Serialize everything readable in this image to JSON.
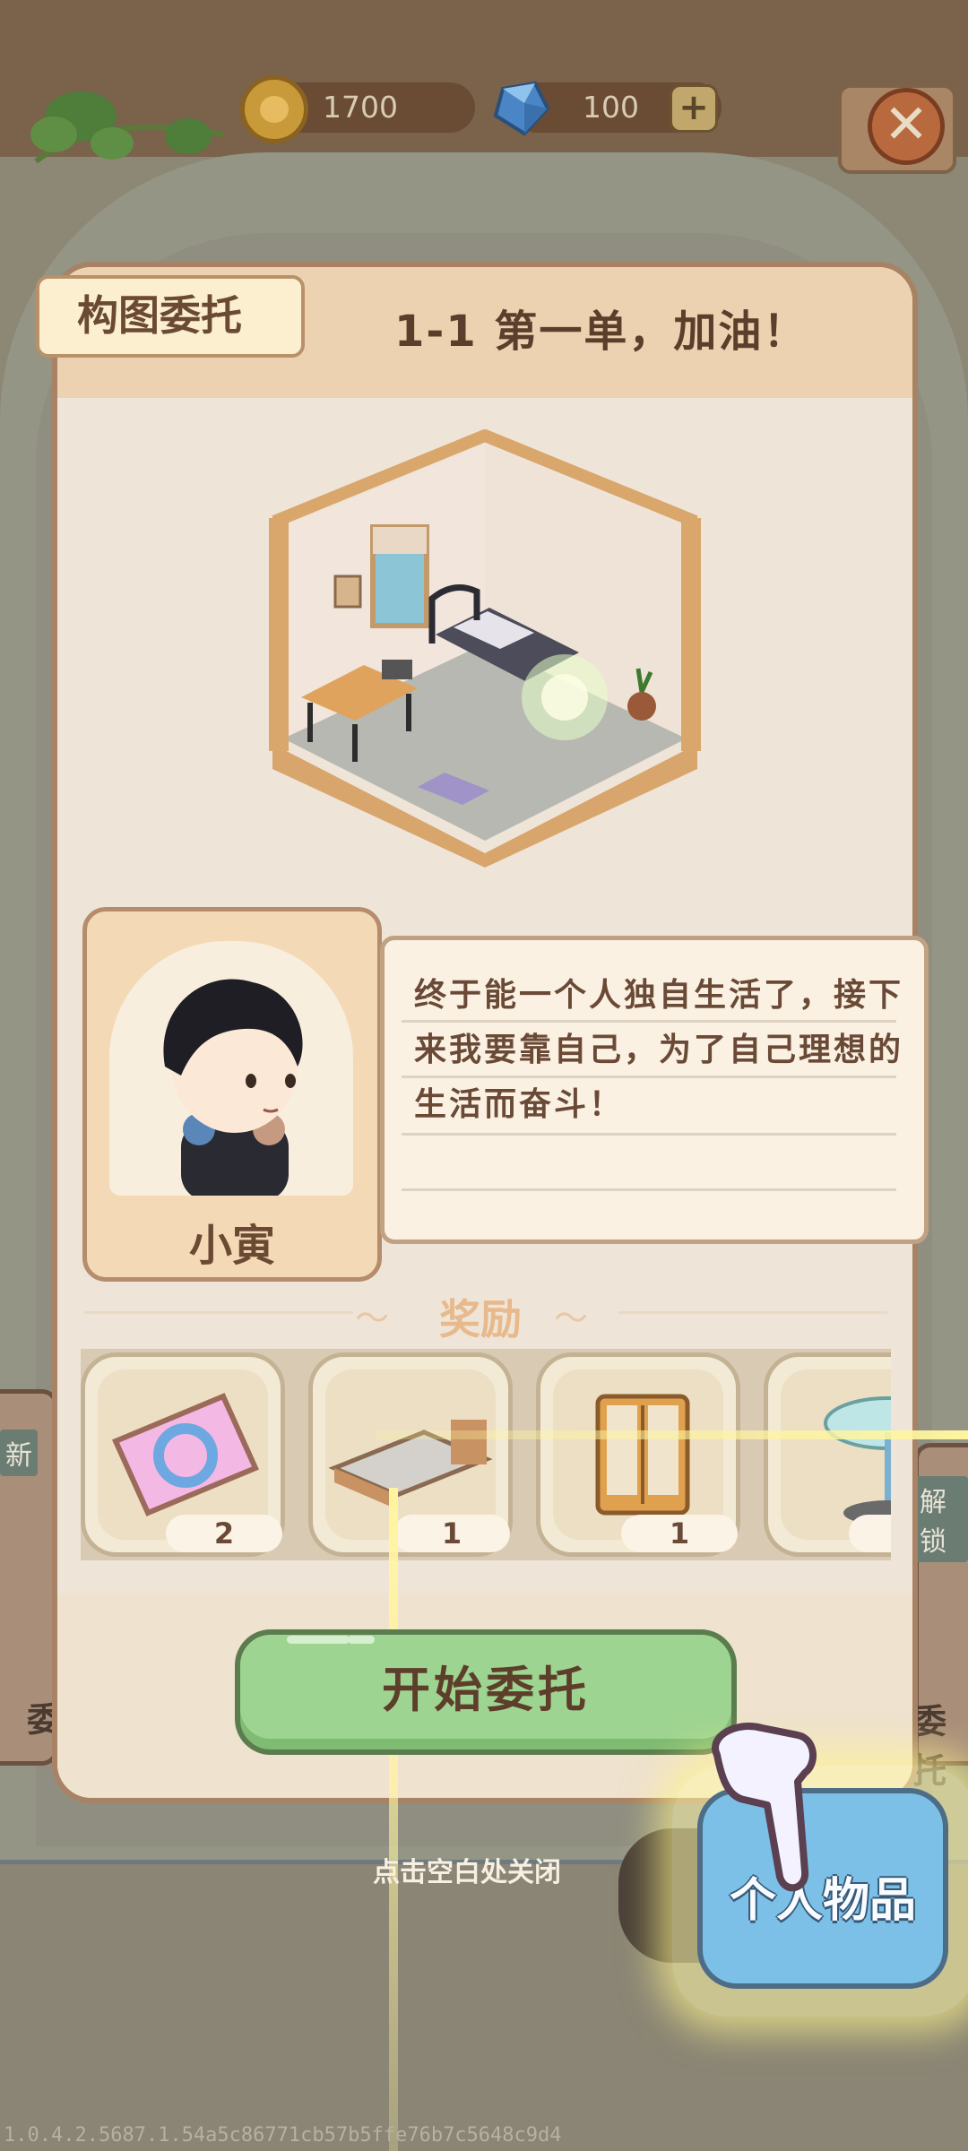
{
  "currency": {
    "coins": "1700",
    "gems": "100",
    "coin_icon": "cat-coin-icon",
    "gem_icon": "blue-gem-icon"
  },
  "panel": {
    "tag": "构图委托",
    "title": "1-1 第一单，加油！"
  },
  "character": {
    "name": "小寅",
    "dialogue": "终于能一个人独自生活了，接下来我要靠自己，为了自己理想的生活而奋斗！"
  },
  "rewards": {
    "title": "奖励",
    "items": [
      {
        "icon": "refresh-ticket-icon",
        "count": "2"
      },
      {
        "icon": "bed-icon",
        "count": "1"
      },
      {
        "icon": "cabinet-icon",
        "count": "1"
      },
      {
        "icon": "glass-table-icon",
        "count": ""
      }
    ]
  },
  "buttons": {
    "start": "开始委托",
    "personal_items": "个人物品"
  },
  "hint": "点击空白处关闭",
  "background": {
    "left_card_tag": "新",
    "left_card_text": "委",
    "right_card_tag": "解锁",
    "right_card_text": "委托"
  },
  "version": "1.0.4.2.5687.1.54a5c86771cb57b5ffe76b7c5648c9d4",
  "colors": {
    "start_button": "#9ed491",
    "personal_button": "#7cc0e8",
    "panel_bg": "#f2e8d7",
    "accent_brown": "#6b4a34"
  }
}
